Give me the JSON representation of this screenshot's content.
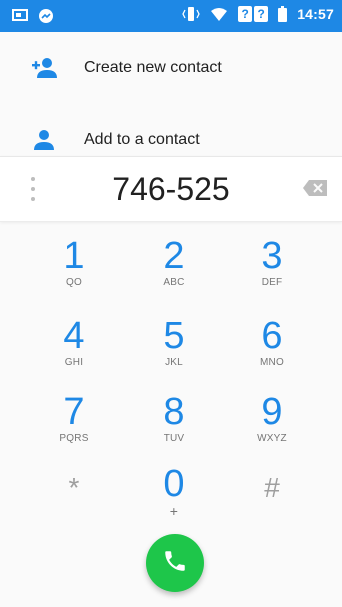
{
  "status_bar": {
    "time": "14:57",
    "sim_label_1": "?",
    "sim_label_2": "?",
    "colors": {
      "background": "#1e88e5"
    },
    "icons": [
      "notification-square-icon",
      "messenger-icon",
      "vibrate-icon",
      "wifi-icon",
      "battery-icon"
    ]
  },
  "suggestions": [
    {
      "label": "Create new contact",
      "icon": "add-person-icon"
    },
    {
      "label": "Add to a contact",
      "icon": "person-icon"
    }
  ],
  "dial_field": {
    "value": "746-525",
    "overflow_icon": "overflow-dots-icon",
    "backspace_icon": "backspace-icon"
  },
  "keypad": [
    {
      "digit": "1",
      "letters": "QO"
    },
    {
      "digit": "2",
      "letters": "ABC"
    },
    {
      "digit": "3",
      "letters": "DEF"
    },
    {
      "digit": "4",
      "letters": "GHI"
    },
    {
      "digit": "5",
      "letters": "JKL"
    },
    {
      "digit": "6",
      "letters": "MNO"
    },
    {
      "digit": "7",
      "letters": "PQRS"
    },
    {
      "digit": "8",
      "letters": "TUV"
    },
    {
      "digit": "9",
      "letters": "WXYZ"
    },
    {
      "digit": "*",
      "letters": ""
    },
    {
      "digit": "0",
      "letters": "+"
    },
    {
      "digit": "#",
      "letters": ""
    }
  ],
  "call_button": {
    "icon": "phone-icon",
    "color": "#1ec64a"
  },
  "accent_color": "#1e88e5"
}
